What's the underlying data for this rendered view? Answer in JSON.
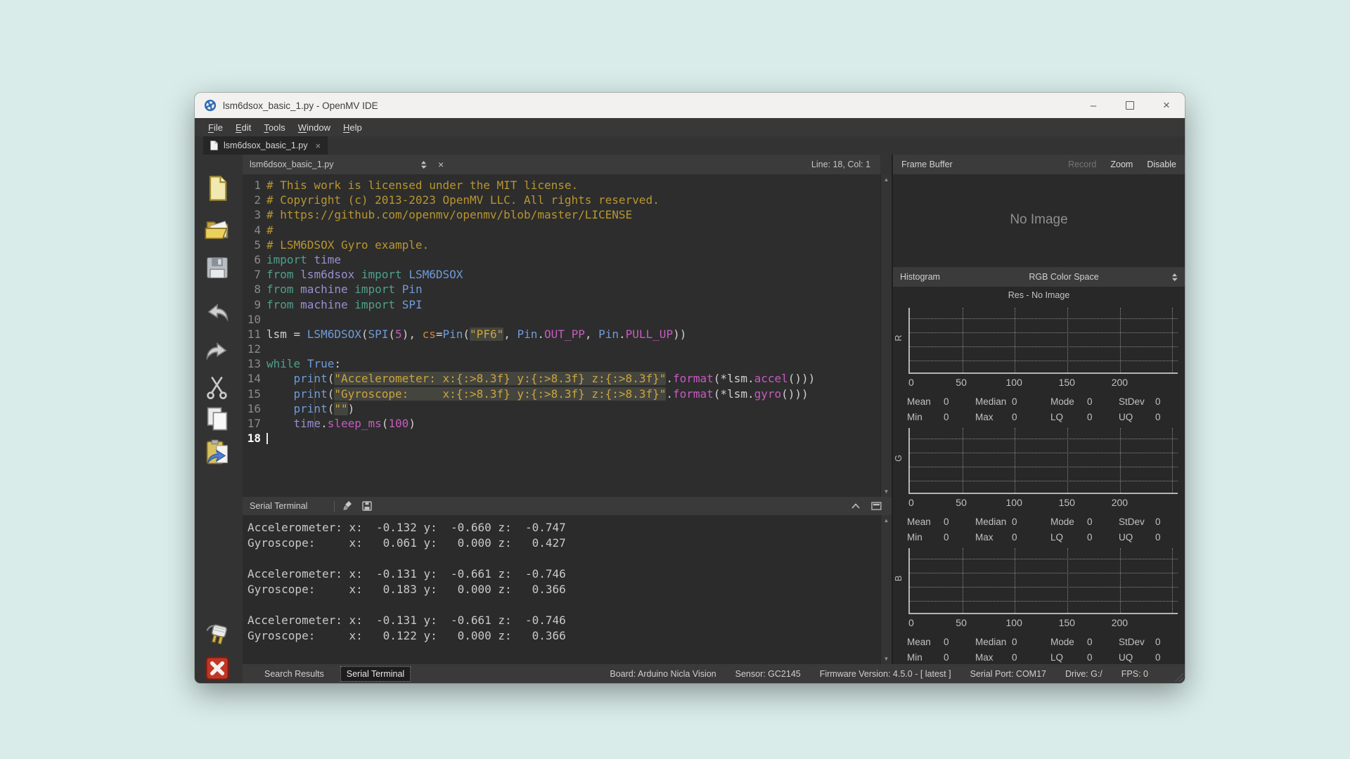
{
  "window": {
    "title": "lsm6dsox_basic_1.py - OpenMV IDE",
    "controls": [
      "minimize",
      "maximize",
      "close"
    ]
  },
  "menu": {
    "items": [
      "File",
      "Edit",
      "Tools",
      "Window",
      "Help"
    ]
  },
  "tab": {
    "label": "lsm6dsox_basic_1.py",
    "close": "×"
  },
  "editor_toolbar": {
    "file_selector": "lsm6dsox_basic_1.py",
    "close": "×",
    "line_col": "Line: 18, Col: 1"
  },
  "toolbar": {
    "icons": [
      "new-file",
      "open-file",
      "save-file",
      "undo",
      "redo",
      "cut",
      "copy",
      "paste",
      "connect",
      "stop-script"
    ]
  },
  "editor": {
    "current_line": 18,
    "lines": [
      {
        "num": 1,
        "tokens": [
          [
            "# This work is licensed under the MIT license.",
            "c"
          ]
        ]
      },
      {
        "num": 2,
        "tokens": [
          [
            "# Copyright (c) 2013-2023 OpenMV LLC. All rights reserved.",
            "c"
          ]
        ]
      },
      {
        "num": 3,
        "tokens": [
          [
            "# https://github.com/openmv/openmv/blob/master/LICENSE",
            "c"
          ]
        ]
      },
      {
        "num": 4,
        "tokens": [
          [
            "#",
            "c"
          ]
        ]
      },
      {
        "num": 5,
        "tokens": [
          [
            "# LSM6DSOX Gyro example.",
            "c"
          ]
        ]
      },
      {
        "num": 6,
        "tokens": [
          [
            "import",
            "k"
          ],
          [
            " ",
            "p"
          ],
          [
            "time",
            "m"
          ]
        ]
      },
      {
        "num": 7,
        "tokens": [
          [
            "from",
            "k"
          ],
          [
            " ",
            "p"
          ],
          [
            "lsm6dsox",
            "m"
          ],
          [
            " ",
            "p"
          ],
          [
            "import",
            "k"
          ],
          [
            " ",
            "p"
          ],
          [
            "LSM6DSOX",
            "t"
          ]
        ]
      },
      {
        "num": 8,
        "tokens": [
          [
            "from",
            "k"
          ],
          [
            " ",
            "p"
          ],
          [
            "machine",
            "m"
          ],
          [
            " ",
            "p"
          ],
          [
            "import",
            "k"
          ],
          [
            " ",
            "p"
          ],
          [
            "Pin",
            "t"
          ]
        ]
      },
      {
        "num": 9,
        "tokens": [
          [
            "from",
            "k"
          ],
          [
            " ",
            "p"
          ],
          [
            "machine",
            "m"
          ],
          [
            " ",
            "p"
          ],
          [
            "import",
            "k"
          ],
          [
            " ",
            "p"
          ],
          [
            "SPI",
            "t"
          ]
        ]
      },
      {
        "num": 10,
        "tokens": []
      },
      {
        "num": 11,
        "tokens": [
          [
            "lsm = ",
            "p"
          ],
          [
            "LSM6DSOX",
            "t"
          ],
          [
            "(",
            "p"
          ],
          [
            "SPI",
            "t"
          ],
          [
            "(",
            "p"
          ],
          [
            "5",
            "n"
          ],
          [
            "), ",
            "p"
          ],
          [
            "cs",
            "a"
          ],
          [
            "=",
            "p"
          ],
          [
            "Pin",
            "t"
          ],
          [
            "(",
            "p"
          ],
          [
            "\"PF6\"",
            "s"
          ],
          [
            ", ",
            "p"
          ],
          [
            "Pin",
            "t"
          ],
          [
            ".",
            "p"
          ],
          [
            "OUT_PP",
            "f"
          ],
          [
            ", ",
            "p"
          ],
          [
            "Pin",
            "t"
          ],
          [
            ".",
            "p"
          ],
          [
            "PULL_UP",
            "f"
          ],
          [
            "))",
            "p"
          ]
        ]
      },
      {
        "num": 12,
        "tokens": []
      },
      {
        "num": 13,
        "tokens": [
          [
            "while",
            "k"
          ],
          [
            " ",
            "p"
          ],
          [
            "True",
            "t"
          ],
          [
            ":",
            "p"
          ]
        ]
      },
      {
        "num": 14,
        "tokens": [
          [
            "    ",
            "p"
          ],
          [
            "print",
            "t"
          ],
          [
            "(",
            "p"
          ],
          [
            "\"Accelerometer: x:{:>8.3f} y:{:>8.3f} z:{:>8.3f}\"",
            "s"
          ],
          [
            ".",
            "p"
          ],
          [
            "format",
            "f"
          ],
          [
            "(*lsm.",
            "p"
          ],
          [
            "accel",
            "f"
          ],
          [
            "()))",
            "p"
          ]
        ]
      },
      {
        "num": 15,
        "tokens": [
          [
            "    ",
            "p"
          ],
          [
            "print",
            "t"
          ],
          [
            "(",
            "p"
          ],
          [
            "\"Gyroscope:     x:{:>8.3f} y:{:>8.3f} z:{:>8.3f}\"",
            "s"
          ],
          [
            ".",
            "p"
          ],
          [
            "format",
            "f"
          ],
          [
            "(*lsm.",
            "p"
          ],
          [
            "gyro",
            "f"
          ],
          [
            "()))",
            "p"
          ]
        ]
      },
      {
        "num": 16,
        "tokens": [
          [
            "    ",
            "p"
          ],
          [
            "print",
            "t"
          ],
          [
            "(",
            "p"
          ],
          [
            "\"\"",
            "s"
          ],
          [
            ")",
            "p"
          ]
        ]
      },
      {
        "num": 17,
        "tokens": [
          [
            "    ",
            "p"
          ],
          [
            "time",
            "m"
          ],
          [
            ".",
            "p"
          ],
          [
            "sleep_ms",
            "f"
          ],
          [
            "(",
            "p"
          ],
          [
            "100",
            "n"
          ],
          [
            ")",
            "p"
          ]
        ]
      },
      {
        "num": 18,
        "tokens": []
      }
    ]
  },
  "serial_terminal": {
    "title": "Serial Terminal",
    "icons": [
      "clear-terminal",
      "save-log"
    ],
    "window_icons": [
      "collapse",
      "detach"
    ],
    "lines": [
      "Accelerometer: x:  -0.132 y:  -0.660 z:  -0.747",
      "Gyroscope:     x:   0.061 y:   0.000 z:   0.427",
      "",
      "Accelerometer: x:  -0.131 y:  -0.661 z:  -0.746",
      "Gyroscope:     x:   0.183 y:   0.000 z:   0.366",
      "",
      "Accelerometer: x:  -0.131 y:  -0.661 z:  -0.746",
      "Gyroscope:     x:   0.122 y:   0.000 z:   0.366"
    ]
  },
  "frame_buffer": {
    "title": "Frame Buffer",
    "placeholder": "No Image",
    "actions": [
      {
        "label": "Record",
        "enabled": false
      },
      {
        "label": "Zoom",
        "enabled": true
      },
      {
        "label": "Disable",
        "enabled": true
      }
    ]
  },
  "histogram": {
    "title": "Histogram",
    "color_space": "RGB Color Space",
    "res_label": "Res - No Image",
    "x_axis_max": 255,
    "x_tick_labels": [
      "0",
      "50",
      "100",
      "150",
      "200"
    ],
    "channels": [
      {
        "label": "R"
      },
      {
        "label": "G"
      },
      {
        "label": "B"
      }
    ],
    "stats_rows": [
      [
        [
          "Mean",
          "0"
        ],
        [
          "Median",
          "0"
        ],
        [
          "Mode",
          "0"
        ],
        [
          "StDev",
          "0"
        ]
      ],
      [
        [
          "Min",
          "0"
        ],
        [
          "Max",
          "0"
        ],
        [
          "LQ",
          "0"
        ],
        [
          "UQ",
          "0"
        ]
      ]
    ]
  },
  "status_bar": {
    "tabs": [
      {
        "label": "Search Results",
        "active": false
      },
      {
        "label": "Serial Terminal",
        "active": true
      }
    ],
    "items": [
      "Board: Arduino Nicla Vision",
      "Sensor: GC2145",
      "Firmware Version: 4.5.0 - [ latest ]",
      "Serial Port: COM17",
      "Drive: G:/",
      "FPS: 0"
    ]
  }
}
